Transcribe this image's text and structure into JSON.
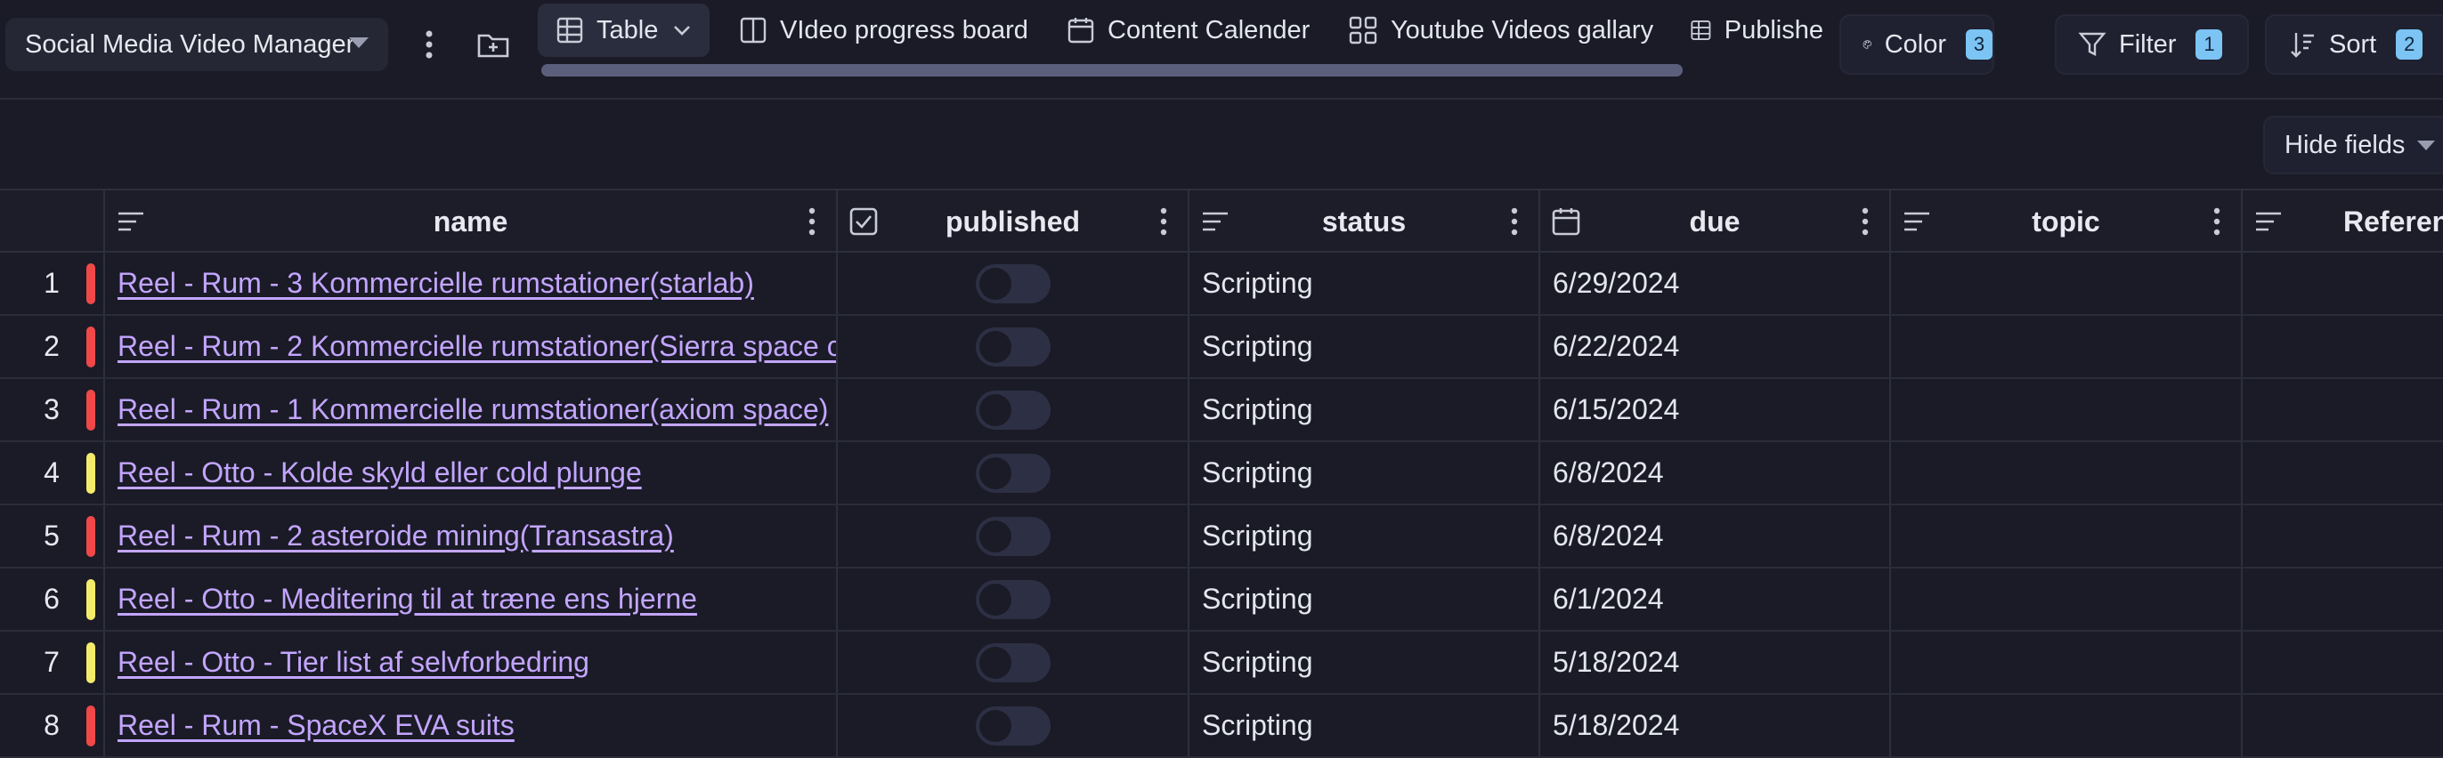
{
  "toolbar": {
    "base_name": "Social Media Video Manager",
    "views": [
      {
        "label": "Table",
        "icon": "table-icon",
        "active": true
      },
      {
        "label": "VIdeo progress board",
        "icon": "board-icon",
        "active": false
      },
      {
        "label": "Content Calender",
        "icon": "calendar-icon",
        "active": false
      },
      {
        "label": "Youtube Videos gallary",
        "icon": "gallery-icon",
        "active": false
      },
      {
        "label": "Publishe",
        "icon": "table-icon",
        "active": false
      }
    ],
    "color": {
      "label": "Color",
      "count": "3"
    },
    "filter": {
      "label": "Filter",
      "count": "1"
    },
    "sort": {
      "label": "Sort",
      "count": "2"
    },
    "hide_fields": "Hide fields"
  },
  "table": {
    "columns": [
      {
        "label": "name",
        "icon": "text-icon"
      },
      {
        "label": "published",
        "icon": "checkbox-icon"
      },
      {
        "label": "status",
        "icon": "text-icon"
      },
      {
        "label": "due",
        "icon": "calendar-icon"
      },
      {
        "label": "topic",
        "icon": "text-icon"
      },
      {
        "label": "Referen",
        "icon": "text-icon"
      }
    ],
    "rows": [
      {
        "index": "1",
        "color": "#f04848",
        "name": "Reel - Rum - 3 Kommercielle rumstationer(starlab)",
        "published": false,
        "status": "Scripting",
        "due": "6/29/2024",
        "topic": "",
        "reference": ""
      },
      {
        "index": "2",
        "color": "#f04848",
        "name": "Reel - Rum - 2 Kommercielle rumstationer(Sierra space c",
        "published": false,
        "status": "Scripting",
        "due": "6/22/2024",
        "topic": "",
        "reference": ""
      },
      {
        "index": "3",
        "color": "#f04848",
        "name": "Reel - Rum - 1 Kommercielle rumstationer(axiom space)",
        "published": false,
        "status": "Scripting",
        "due": "6/15/2024",
        "topic": "",
        "reference": ""
      },
      {
        "index": "4",
        "color": "#f3ec6a",
        "name": "Reel - Otto - Kolde skyld eller cold plunge",
        "published": false,
        "status": "Scripting",
        "due": "6/8/2024",
        "topic": "",
        "reference": ""
      },
      {
        "index": "5",
        "color": "#f04848",
        "name": "Reel - Rum - 2 asteroide mining(Transastra)",
        "published": false,
        "status": "Scripting",
        "due": "6/8/2024",
        "topic": "",
        "reference": ""
      },
      {
        "index": "6",
        "color": "#f3ec6a",
        "name": "Reel - Otto - Meditering til at træne ens hjerne",
        "published": false,
        "status": "Scripting",
        "due": "6/1/2024",
        "topic": "",
        "reference": ""
      },
      {
        "index": "7",
        "color": "#f3ec6a",
        "name": "Reel - Otto - Tier list af selvforbedring",
        "published": false,
        "status": "Scripting",
        "due": "5/18/2024",
        "topic": "",
        "reference": ""
      },
      {
        "index": "8",
        "color": "#f04848",
        "name": "Reel - Rum - SpaceX EVA suits",
        "published": false,
        "status": "Scripting",
        "due": "5/18/2024",
        "topic": "",
        "reference": ""
      }
    ]
  }
}
